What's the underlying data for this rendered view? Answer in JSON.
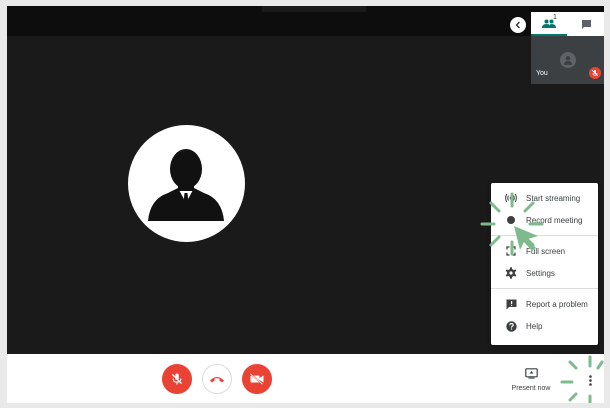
{
  "side_panel": {
    "participant_count": "1",
    "self_label": "You",
    "icons": [
      "people-icon",
      "chat-icon",
      "chevron-left-icon",
      "mic-off-icon",
      "person-icon"
    ]
  },
  "menu": {
    "items": [
      {
        "label": "Start streaming",
        "icon": "broadcast-icon"
      },
      {
        "label": "Record meeting",
        "icon": "record-icon"
      },
      {
        "label": "Full screen",
        "icon": "fullscreen-icon"
      },
      {
        "label": "Settings",
        "icon": "gear-icon"
      },
      {
        "label": "Report a problem",
        "icon": "report-icon"
      },
      {
        "label": "Help",
        "icon": "help-icon"
      }
    ]
  },
  "controls": {
    "present_label": "Present now",
    "icons": [
      "mic-off-icon",
      "hangup-icon",
      "camera-off-icon",
      "present-icon",
      "more-vert-icon"
    ]
  },
  "colors": {
    "stage": "#1a1a1a",
    "danger": "#ea4335",
    "accent": "#00796b",
    "highlight": "#7dbb8c"
  }
}
